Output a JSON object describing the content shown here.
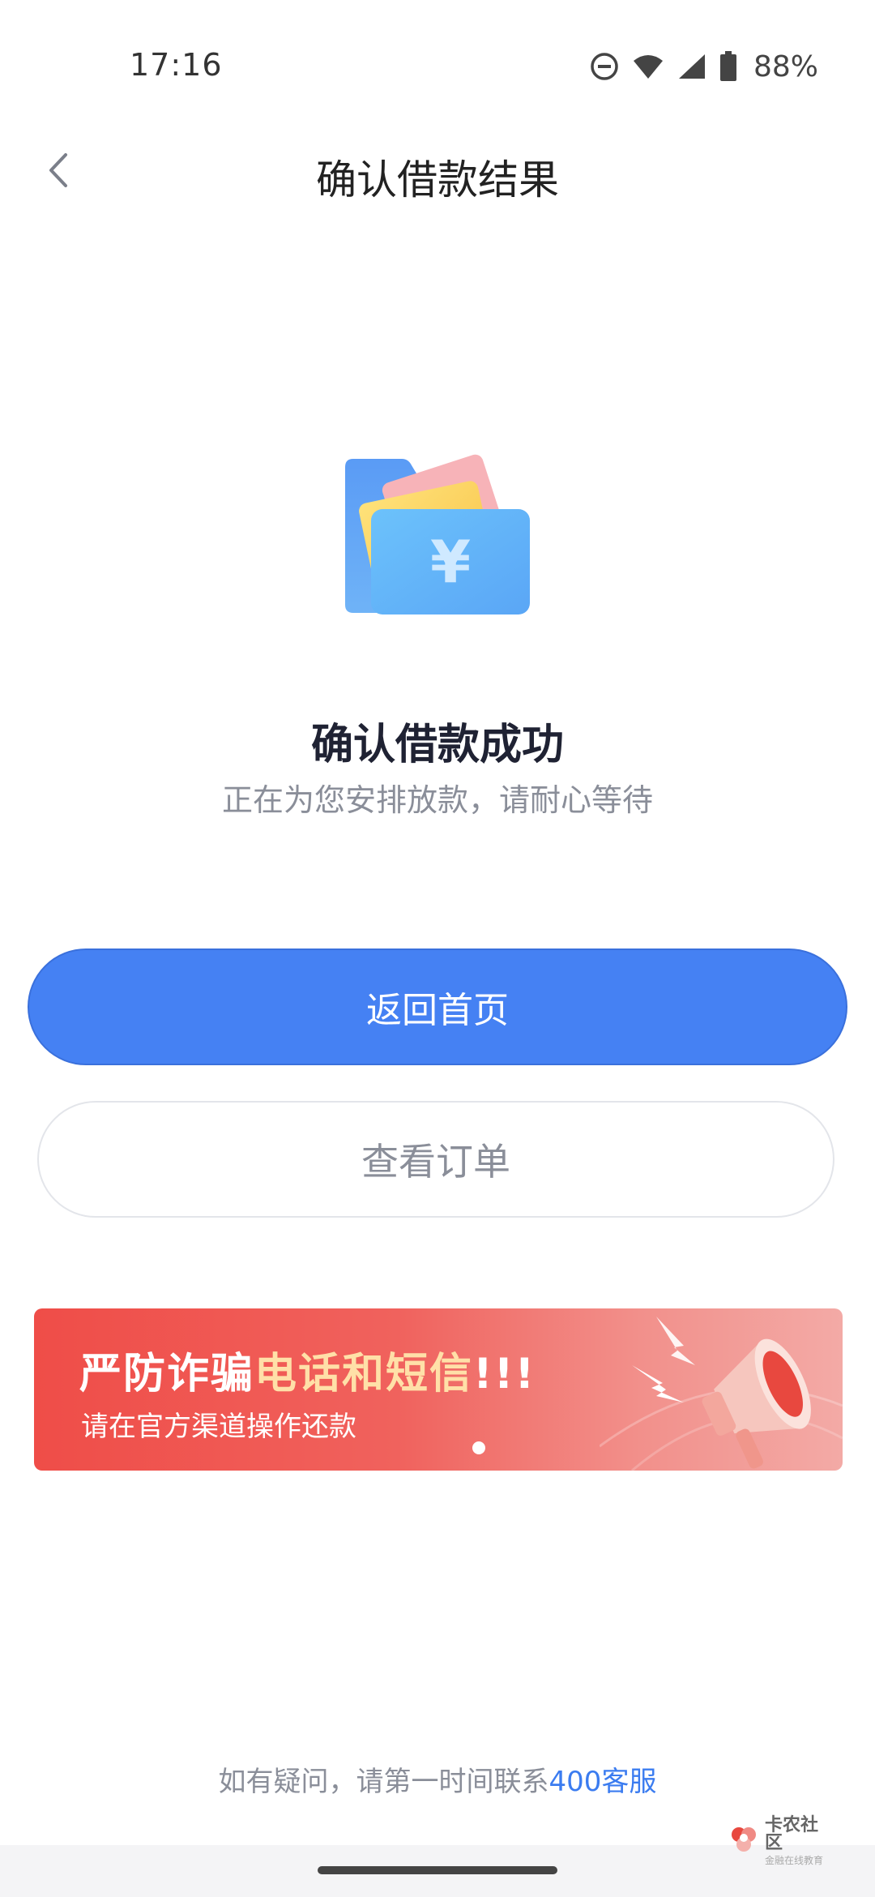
{
  "status_bar": {
    "time": "17:16",
    "battery": "88%",
    "icons": [
      "do-not-disturb-icon",
      "wifi-icon",
      "signal-icon",
      "battery-icon"
    ]
  },
  "nav": {
    "title": "确认借款结果",
    "back_icon": "chevron-left-icon"
  },
  "result": {
    "icon": "wallet-yuan-icon",
    "title": "确认借款成功",
    "subtitle": "正在为您安排放款，请耐心等待"
  },
  "buttons": {
    "primary_label": "返回首页",
    "secondary_label": "查看订单"
  },
  "banner": {
    "title_part1": "严防诈骗",
    "title_part2": "电话和短信",
    "title_part3": "!!!",
    "subtitle": "请在官方渠道操作还款",
    "icon": "megaphone-icon"
  },
  "footer": {
    "contact_prefix": "如有疑问，请第一时间联系",
    "contact_link": "400客服"
  },
  "watermark": {
    "main": "卡农社区",
    "sub": "金融在线教育"
  },
  "colors": {
    "primary": "#4581f3",
    "banner_red": "#ef4d48",
    "link": "#3b7cf0"
  }
}
